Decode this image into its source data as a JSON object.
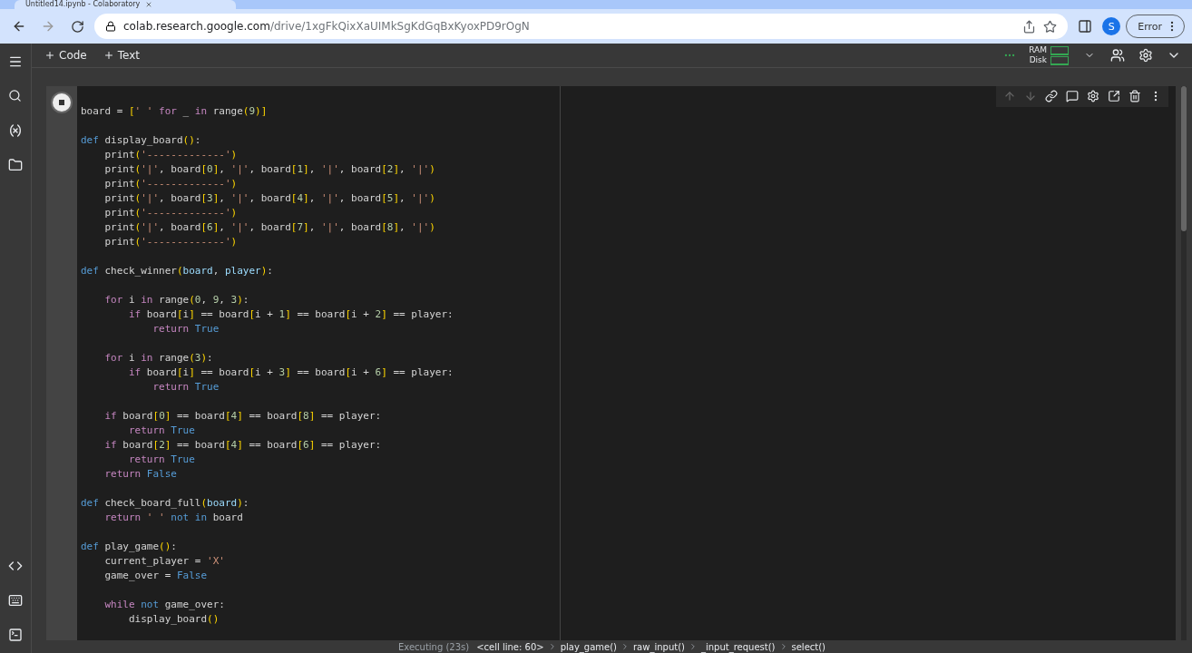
{
  "browser": {
    "tab_title": "Untitled14.ipynb - Colaboratory",
    "url_host": "colab.research.google.com",
    "url_path": "/drive/1xgFkQixXaUIMkSgKdGqBxKyoxPD9rOgN",
    "avatar": "S",
    "profile_status": "Error"
  },
  "toolbar": {
    "add_buttons": [
      "Code",
      "Text"
    ],
    "resources": [
      "RAM",
      "Disk"
    ]
  },
  "cell": {
    "running": true,
    "blocks": [
      [
        [
          {
            "kind": "plain",
            "text": "board = "
          },
          {
            "kind": "bracket",
            "text": "["
          },
          {
            "kind": "string",
            "text": "' '"
          },
          {
            "kind": "keyword",
            "text": " for"
          },
          {
            "kind": "plain",
            "text": " _ "
          },
          {
            "kind": "keyword",
            "text": "in"
          },
          {
            "kind": "plain",
            "text": " range"
          },
          {
            "kind": "bracket",
            "text": "("
          },
          {
            "kind": "number",
            "text": "9"
          },
          {
            "kind": "bracket",
            "text": ")]"
          }
        ]
      ],
      [
        [
          {
            "kind": "def",
            "text": "def"
          },
          {
            "kind": "plain",
            "text": " display_board"
          },
          {
            "kind": "bracket",
            "text": "()"
          },
          {
            "kind": "plain",
            "text": ":"
          }
        ],
        [
          {
            "kind": "plain",
            "text": "    print"
          },
          {
            "kind": "bracket",
            "text": "("
          },
          {
            "kind": "string",
            "text": "'-------------'"
          },
          {
            "kind": "bracket",
            "text": ")"
          }
        ],
        [
          {
            "kind": "plain",
            "text": "    print"
          },
          {
            "kind": "bracket",
            "text": "("
          },
          {
            "kind": "string",
            "text": "'|'"
          },
          {
            "kind": "plain",
            "text": ", board"
          },
          {
            "kind": "bracket",
            "text": "["
          },
          {
            "kind": "number",
            "text": "0"
          },
          {
            "kind": "bracket",
            "text": "]"
          },
          {
            "kind": "plain",
            "text": ", "
          },
          {
            "kind": "string",
            "text": "'|'"
          },
          {
            "kind": "plain",
            "text": ", board"
          },
          {
            "kind": "bracket",
            "text": "["
          },
          {
            "kind": "number",
            "text": "1"
          },
          {
            "kind": "bracket",
            "text": "]"
          },
          {
            "kind": "plain",
            "text": ", "
          },
          {
            "kind": "string",
            "text": "'|'"
          },
          {
            "kind": "plain",
            "text": ", board"
          },
          {
            "kind": "bracket",
            "text": "["
          },
          {
            "kind": "number",
            "text": "2"
          },
          {
            "kind": "bracket",
            "text": "]"
          },
          {
            "kind": "plain",
            "text": ", "
          },
          {
            "kind": "string",
            "text": "'|'"
          },
          {
            "kind": "bracket",
            "text": ")"
          }
        ],
        [
          {
            "kind": "plain",
            "text": "    print"
          },
          {
            "kind": "bracket",
            "text": "("
          },
          {
            "kind": "string",
            "text": "'-------------'"
          },
          {
            "kind": "bracket",
            "text": ")"
          }
        ],
        [
          {
            "kind": "plain",
            "text": "    print"
          },
          {
            "kind": "bracket",
            "text": "("
          },
          {
            "kind": "string",
            "text": "'|'"
          },
          {
            "kind": "plain",
            "text": ", board"
          },
          {
            "kind": "bracket",
            "text": "["
          },
          {
            "kind": "number",
            "text": "3"
          },
          {
            "kind": "bracket",
            "text": "]"
          },
          {
            "kind": "plain",
            "text": ", "
          },
          {
            "kind": "string",
            "text": "'|'"
          },
          {
            "kind": "plain",
            "text": ", board"
          },
          {
            "kind": "bracket",
            "text": "["
          },
          {
            "kind": "number",
            "text": "4"
          },
          {
            "kind": "bracket",
            "text": "]"
          },
          {
            "kind": "plain",
            "text": ", "
          },
          {
            "kind": "string",
            "text": "'|'"
          },
          {
            "kind": "plain",
            "text": ", board"
          },
          {
            "kind": "bracket",
            "text": "["
          },
          {
            "kind": "number",
            "text": "5"
          },
          {
            "kind": "bracket",
            "text": "]"
          },
          {
            "kind": "plain",
            "text": ", "
          },
          {
            "kind": "string",
            "text": "'|'"
          },
          {
            "kind": "bracket",
            "text": ")"
          }
        ],
        [
          {
            "kind": "plain",
            "text": "    print"
          },
          {
            "kind": "bracket",
            "text": "("
          },
          {
            "kind": "string",
            "text": "'-------------'"
          },
          {
            "kind": "bracket",
            "text": ")"
          }
        ],
        [
          {
            "kind": "plain",
            "text": "    print"
          },
          {
            "kind": "bracket",
            "text": "("
          },
          {
            "kind": "string",
            "text": "'|'"
          },
          {
            "kind": "plain",
            "text": ", board"
          },
          {
            "kind": "bracket",
            "text": "["
          },
          {
            "kind": "number",
            "text": "6"
          },
          {
            "kind": "bracket",
            "text": "]"
          },
          {
            "kind": "plain",
            "text": ", "
          },
          {
            "kind": "string",
            "text": "'|'"
          },
          {
            "kind": "plain",
            "text": ", board"
          },
          {
            "kind": "bracket",
            "text": "["
          },
          {
            "kind": "number",
            "text": "7"
          },
          {
            "kind": "bracket",
            "text": "]"
          },
          {
            "kind": "plain",
            "text": ", "
          },
          {
            "kind": "string",
            "text": "'|'"
          },
          {
            "kind": "plain",
            "text": ", board"
          },
          {
            "kind": "bracket",
            "text": "["
          },
          {
            "kind": "number",
            "text": "8"
          },
          {
            "kind": "bracket",
            "text": "]"
          },
          {
            "kind": "plain",
            "text": ", "
          },
          {
            "kind": "string",
            "text": "'|'"
          },
          {
            "kind": "bracket",
            "text": ")"
          }
        ],
        [
          {
            "kind": "plain",
            "text": "    print"
          },
          {
            "kind": "bracket",
            "text": "("
          },
          {
            "kind": "string",
            "text": "'-------------'"
          },
          {
            "kind": "bracket",
            "text": ")"
          }
        ]
      ],
      [
        [
          {
            "kind": "def",
            "text": "def"
          },
          {
            "kind": "plain",
            "text": " check_winner"
          },
          {
            "kind": "bracket",
            "text": "("
          },
          {
            "kind": "param",
            "text": "board"
          },
          {
            "kind": "plain",
            "text": ", "
          },
          {
            "kind": "param",
            "text": "player"
          },
          {
            "kind": "bracket",
            "text": ")"
          },
          {
            "kind": "plain",
            "text": ":"
          }
        ]
      ],
      [
        [
          {
            "kind": "keyword",
            "text": "    for"
          },
          {
            "kind": "plain",
            "text": " i "
          },
          {
            "kind": "keyword",
            "text": "in"
          },
          {
            "kind": "plain",
            "text": " range"
          },
          {
            "kind": "bracket",
            "text": "("
          },
          {
            "kind": "number",
            "text": "0"
          },
          {
            "kind": "plain",
            "text": ", "
          },
          {
            "kind": "number",
            "text": "9"
          },
          {
            "kind": "plain",
            "text": ", "
          },
          {
            "kind": "number",
            "text": "3"
          },
          {
            "kind": "bracket",
            "text": ")"
          },
          {
            "kind": "plain",
            "text": ":"
          }
        ],
        [
          {
            "kind": "keyword",
            "text": "        if"
          },
          {
            "kind": "plain",
            "text": " board"
          },
          {
            "kind": "bracket",
            "text": "["
          },
          {
            "kind": "plain",
            "text": "i"
          },
          {
            "kind": "bracket",
            "text": "]"
          },
          {
            "kind": "plain",
            "text": " == board"
          },
          {
            "kind": "bracket",
            "text": "["
          },
          {
            "kind": "plain",
            "text": "i + "
          },
          {
            "kind": "number",
            "text": "1"
          },
          {
            "kind": "bracket",
            "text": "]"
          },
          {
            "kind": "plain",
            "text": " == board"
          },
          {
            "kind": "bracket",
            "text": "["
          },
          {
            "kind": "plain",
            "text": "i + "
          },
          {
            "kind": "number",
            "text": "2"
          },
          {
            "kind": "bracket",
            "text": "]"
          },
          {
            "kind": "plain",
            "text": " == player:"
          }
        ],
        [
          {
            "kind": "keyword",
            "text": "            return"
          },
          {
            "kind": "const",
            "text": " True"
          }
        ]
      ],
      [
        [
          {
            "kind": "keyword",
            "text": "    for"
          },
          {
            "kind": "plain",
            "text": " i "
          },
          {
            "kind": "keyword",
            "text": "in"
          },
          {
            "kind": "plain",
            "text": " range"
          },
          {
            "kind": "bracket",
            "text": "("
          },
          {
            "kind": "number",
            "text": "3"
          },
          {
            "kind": "bracket",
            "text": ")"
          },
          {
            "kind": "plain",
            "text": ":"
          }
        ],
        [
          {
            "kind": "keyword",
            "text": "        if"
          },
          {
            "kind": "plain",
            "text": " board"
          },
          {
            "kind": "bracket",
            "text": "["
          },
          {
            "kind": "plain",
            "text": "i"
          },
          {
            "kind": "bracket",
            "text": "]"
          },
          {
            "kind": "plain",
            "text": " == board"
          },
          {
            "kind": "bracket",
            "text": "["
          },
          {
            "kind": "plain",
            "text": "i + "
          },
          {
            "kind": "number",
            "text": "3"
          },
          {
            "kind": "bracket",
            "text": "]"
          },
          {
            "kind": "plain",
            "text": " == board"
          },
          {
            "kind": "bracket",
            "text": "["
          },
          {
            "kind": "plain",
            "text": "i + "
          },
          {
            "kind": "number",
            "text": "6"
          },
          {
            "kind": "bracket",
            "text": "]"
          },
          {
            "kind": "plain",
            "text": " == player:"
          }
        ],
        [
          {
            "kind": "keyword",
            "text": "            return"
          },
          {
            "kind": "const",
            "text": " True"
          }
        ]
      ],
      [
        [
          {
            "kind": "keyword",
            "text": "    if"
          },
          {
            "kind": "plain",
            "text": " board"
          },
          {
            "kind": "bracket",
            "text": "["
          },
          {
            "kind": "number",
            "text": "0"
          },
          {
            "kind": "bracket",
            "text": "]"
          },
          {
            "kind": "plain",
            "text": " == board"
          },
          {
            "kind": "bracket",
            "text": "["
          },
          {
            "kind": "number",
            "text": "4"
          },
          {
            "kind": "bracket",
            "text": "]"
          },
          {
            "kind": "plain",
            "text": " == board"
          },
          {
            "kind": "bracket",
            "text": "["
          },
          {
            "kind": "number",
            "text": "8"
          },
          {
            "kind": "bracket",
            "text": "]"
          },
          {
            "kind": "plain",
            "text": " == player:"
          }
        ],
        [
          {
            "kind": "keyword",
            "text": "        return"
          },
          {
            "kind": "const",
            "text": " True"
          }
        ],
        [
          {
            "kind": "keyword",
            "text": "    if"
          },
          {
            "kind": "plain",
            "text": " board"
          },
          {
            "kind": "bracket",
            "text": "["
          },
          {
            "kind": "number",
            "text": "2"
          },
          {
            "kind": "bracket",
            "text": "]"
          },
          {
            "kind": "plain",
            "text": " == board"
          },
          {
            "kind": "bracket",
            "text": "["
          },
          {
            "kind": "number",
            "text": "4"
          },
          {
            "kind": "bracket",
            "text": "]"
          },
          {
            "kind": "plain",
            "text": " == board"
          },
          {
            "kind": "bracket",
            "text": "["
          },
          {
            "kind": "number",
            "text": "6"
          },
          {
            "kind": "bracket",
            "text": "]"
          },
          {
            "kind": "plain",
            "text": " == player:"
          }
        ],
        [
          {
            "kind": "keyword",
            "text": "        return"
          },
          {
            "kind": "const",
            "text": " True"
          }
        ],
        [
          {
            "kind": "keyword",
            "text": "    return"
          },
          {
            "kind": "const",
            "text": " False"
          }
        ]
      ],
      [
        [
          {
            "kind": "def",
            "text": "def"
          },
          {
            "kind": "plain",
            "text": " check_board_full"
          },
          {
            "kind": "bracket",
            "text": "("
          },
          {
            "kind": "param",
            "text": "board"
          },
          {
            "kind": "bracket",
            "text": ")"
          },
          {
            "kind": "plain",
            "text": ":"
          }
        ],
        [
          {
            "kind": "keyword",
            "text": "    return"
          },
          {
            "kind": "string",
            "text": " ' '"
          },
          {
            "kind": "def",
            "text": " not in"
          },
          {
            "kind": "plain",
            "text": " board"
          }
        ]
      ],
      [
        [
          {
            "kind": "def",
            "text": "def"
          },
          {
            "kind": "plain",
            "text": " play_game"
          },
          {
            "kind": "bracket",
            "text": "()"
          },
          {
            "kind": "plain",
            "text": ":"
          }
        ],
        [
          {
            "kind": "plain",
            "text": "    current_player = "
          },
          {
            "kind": "string",
            "text": "'X'"
          }
        ],
        [
          {
            "kind": "plain",
            "text": "    game_over = "
          },
          {
            "kind": "const",
            "text": "False"
          }
        ]
      ],
      [
        [
          {
            "kind": "keyword",
            "text": "    while"
          },
          {
            "kind": "def",
            "text": " not"
          },
          {
            "kind": "plain",
            "text": " game_over:"
          }
        ],
        [
          {
            "kind": "plain",
            "text": "        display_board"
          },
          {
            "kind": "bracket",
            "text": "()"
          }
        ]
      ]
    ]
  },
  "status_bar": {
    "status": "Executing (23s)",
    "trace": [
      "<cell line: 60>",
      "play_game()",
      "raw_input()",
      "_input_request()",
      "select()"
    ]
  }
}
